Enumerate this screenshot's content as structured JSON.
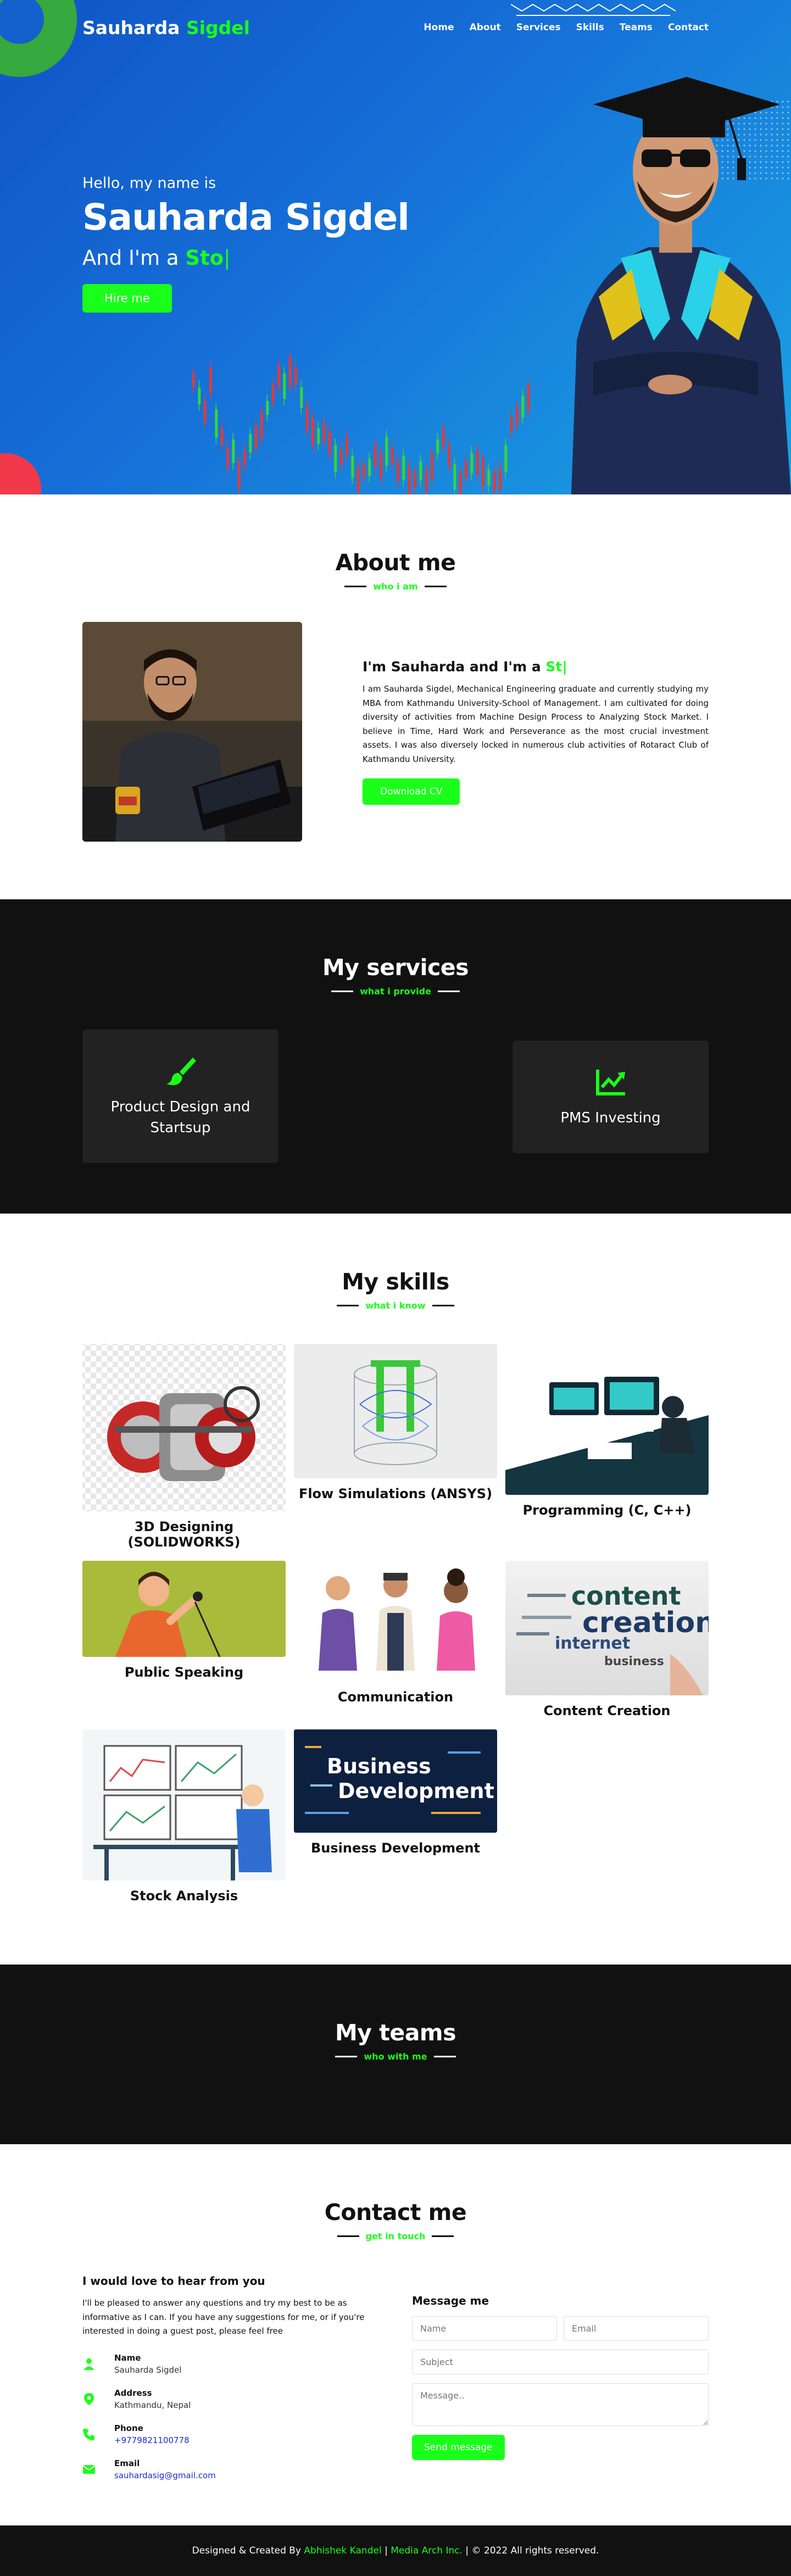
{
  "nav": {
    "logo_first": "Sauharda",
    "logo_second": "Sigdel",
    "items": [
      "Home",
      "About",
      "Services",
      "Skills",
      "Teams",
      "Contact"
    ]
  },
  "hero": {
    "hello": "Hello, my name is",
    "name": "Sauharda Sigdel",
    "role_prefix": "And I'm a",
    "role_typed": "Sto",
    "caret": "|",
    "button": "Hire me"
  },
  "about": {
    "title": "About me",
    "subtitle": "who i am",
    "heading_prefix": "I'm Sauharda and I'm a",
    "heading_typed": "St",
    "caret": "|",
    "paragraph": "I am Sauharda Sigdel, Mechanical Engineering graduate and currently studying my MBA from Kathmandu University-School of Management. I am cultivated for doing diversity of activities from Machine Design Process to Analyzing Stock Market. I believe in Time, Hard Work and Perseverance as the most crucial investment assets. I was also diversely locked in numerous club activities of Rotaract Club of Kathmandu University.",
    "button": "Download CV"
  },
  "services": {
    "title": "My services",
    "subtitle": "what i provide",
    "items": [
      {
        "label": "Product Design and Startsup",
        "icon": "paintbrush-icon"
      },
      {
        "label": "PMS Investing",
        "icon": "chart-line-icon"
      }
    ]
  },
  "skills": {
    "title": "My skills",
    "subtitle": "what i know",
    "items": [
      "3D Designing (SOLIDWORKS)",
      "Flow Simulations (ANSYS)",
      "Programming (C, C++)",
      "Public Speaking",
      "Communication",
      "Content Creation",
      "Stock Analysis",
      "Business Development"
    ],
    "img_words": {
      "content": "content",
      "creation": "creation",
      "internet": "internet",
      "business_small": "business",
      "business": "Business",
      "development": "Development"
    }
  },
  "teams": {
    "title": "My teams",
    "subtitle": "who with me"
  },
  "contact": {
    "title": "Contact me",
    "subtitle": "get in touch",
    "heading": "I would love to hear from you",
    "intro": "I'll be pleased to answer any questions and try my best to be as informative as I can. If you have any suggestions for me, or if you're interested in doing a guest post, please feel free",
    "info": [
      {
        "title": "Name",
        "value": "Sauharda Sigdel",
        "icon": "user-icon"
      },
      {
        "title": "Address",
        "value": "Kathmandu, Nepal",
        "icon": "map-pin-icon"
      },
      {
        "title": "Phone",
        "value": "+9779821100778",
        "icon": "phone-icon"
      },
      {
        "title": "Email",
        "value": "sauhardasig@gmail.com",
        "icon": "envelope-icon"
      }
    ],
    "form": {
      "heading": "Message me",
      "name_placeholder": "Name",
      "email_placeholder": "Email",
      "subject_placeholder": "Subject",
      "message_placeholder": "Message..",
      "button": "Send message"
    }
  },
  "footer": {
    "prefix": "Designed & Created By",
    "author": "Abhishek Kandel",
    "separator": "|",
    "company": "Media Arch Inc.",
    "copyright": "| © 2022 All rights reserved."
  },
  "colors": {
    "accent": "#1aff1a",
    "hero_start": "#1054c6",
    "hero_end": "#1aa3e3",
    "dark": "#111111",
    "card": "#222222"
  }
}
